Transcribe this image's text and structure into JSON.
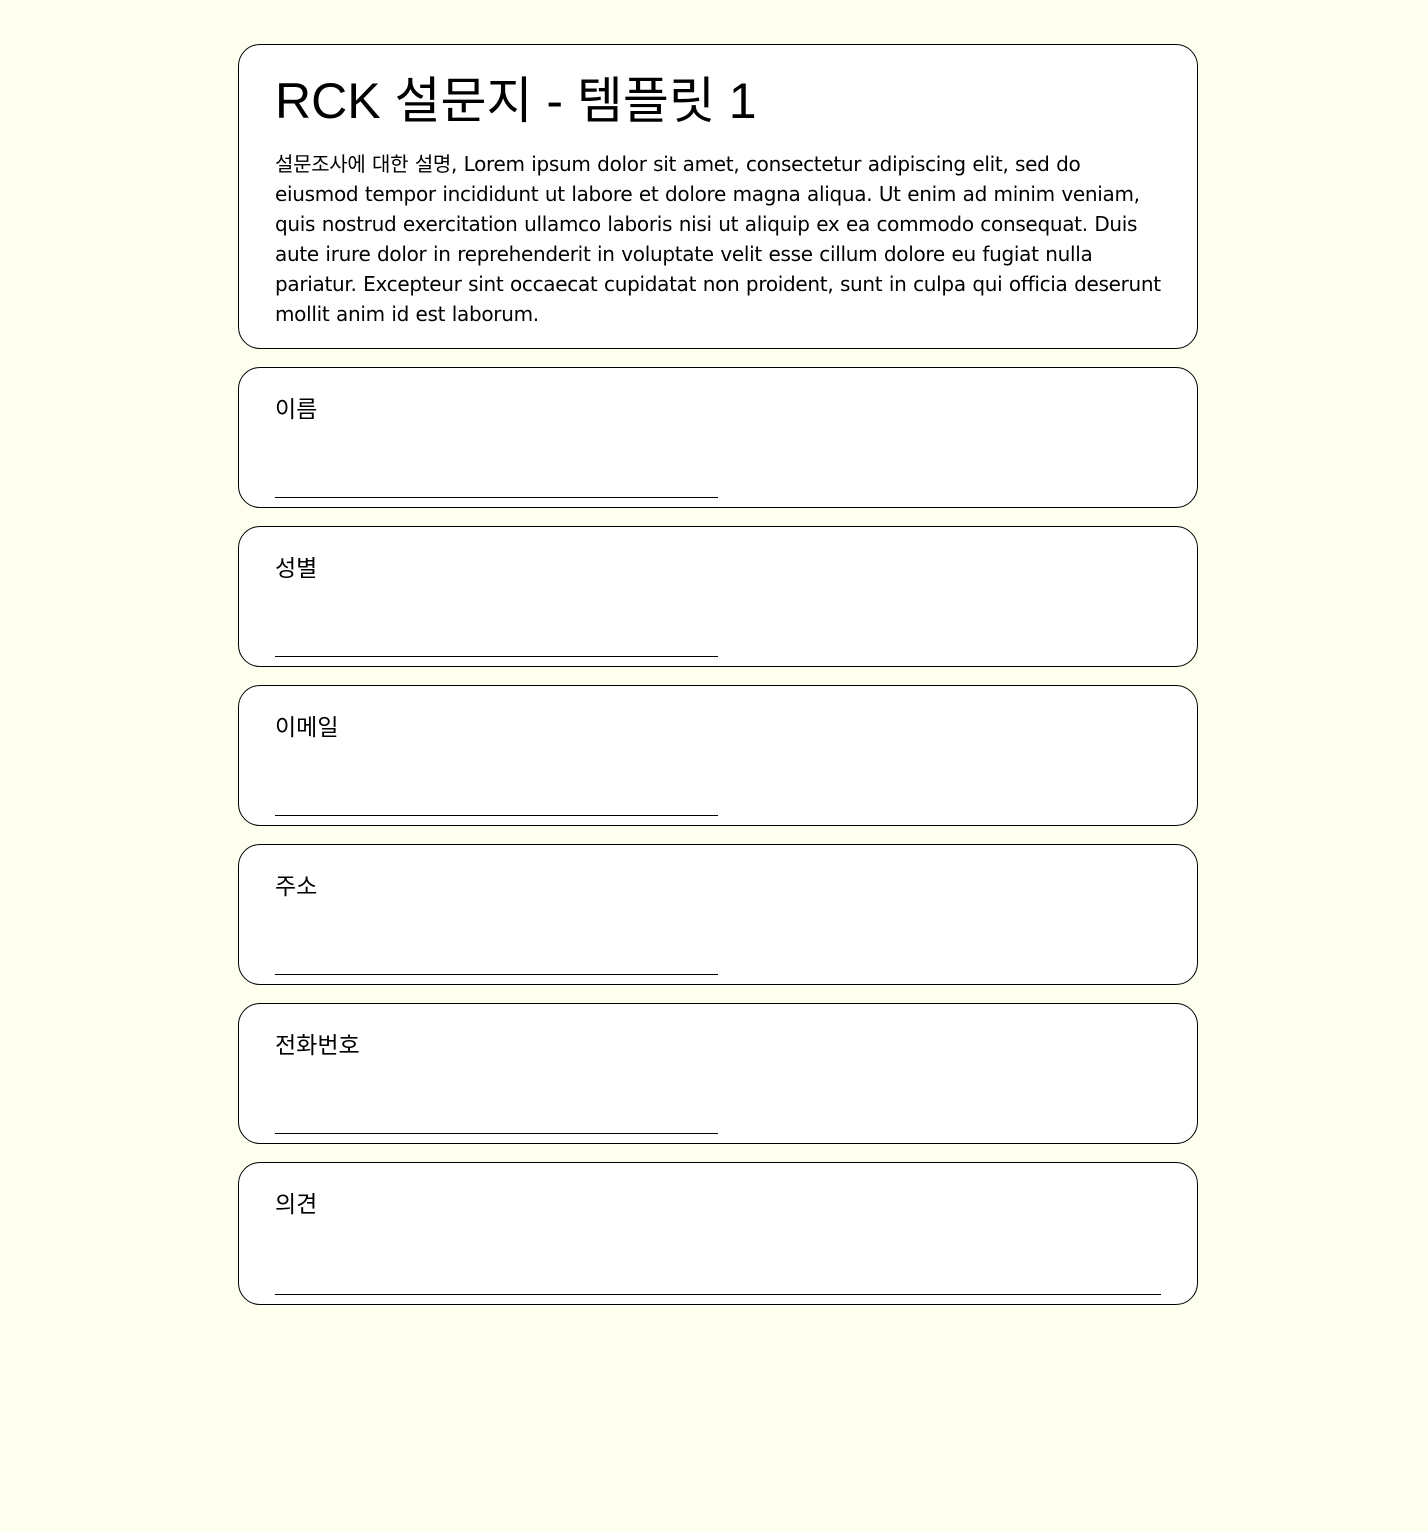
{
  "survey": {
    "title": "RCK 설문지 - 템플릿 1",
    "description": "설문조사에 대한 설명, Lorem ipsum dolor sit amet, consectetur adipiscing elit, sed do eiusmod tempor incididunt ut labore et dolore magna aliqua. Ut enim ad minim veniam, quis nostrud exercitation ullamco laboris nisi ut aliquip ex ea commodo consequat. Duis aute irure dolor in reprehenderit in voluptate velit esse cillum dolore eu fugiat nulla pariatur. Excepteur sint occaecat cupidatat non proident, sunt in culpa qui officia deserunt mollit anim id est laborum."
  },
  "questions": [
    {
      "label": "이름",
      "value": ""
    },
    {
      "label": "성별",
      "value": ""
    },
    {
      "label": "이메일",
      "value": ""
    },
    {
      "label": "주소",
      "value": ""
    },
    {
      "label": "전화번호",
      "value": ""
    },
    {
      "label": "의견",
      "value": ""
    }
  ],
  "colors": {
    "page_background": "#fffff0",
    "card_background": "#ffffff",
    "border": "#000000"
  }
}
